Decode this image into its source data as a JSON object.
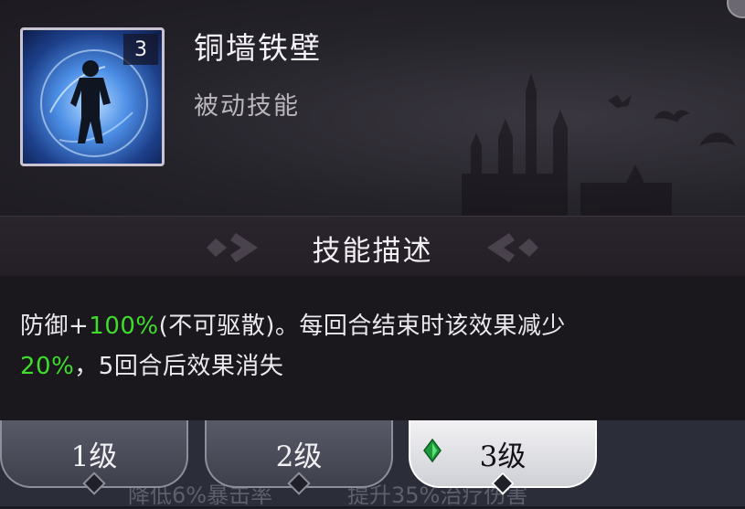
{
  "skill": {
    "name": "铜墙铁壁",
    "type": "被动技能",
    "level_badge": "3"
  },
  "description": {
    "title": "技能描述",
    "line1": [
      {
        "text": "防御+",
        "highlight": false
      },
      {
        "text": "100%",
        "highlight": true
      },
      {
        "text": "(不可驱散)。每回合结束时该效果减少",
        "highlight": false
      }
    ],
    "line2": [
      {
        "text": "20%",
        "highlight": true
      },
      {
        "text": "，5回合后效果消失",
        "highlight": false
      }
    ]
  },
  "tabs": [
    {
      "label": "1级",
      "active": false
    },
    {
      "label": "2级",
      "active": false
    },
    {
      "label": "3级",
      "active": true,
      "icon": "green-gem-icon"
    }
  ],
  "partial_text": {
    "left": "降低6%暴击率",
    "right": "提升35%治疗伤害"
  },
  "colors": {
    "highlight": "#3fdc2c",
    "active_tab": "#f2f2f4",
    "inactive_tab": "#585a67"
  }
}
